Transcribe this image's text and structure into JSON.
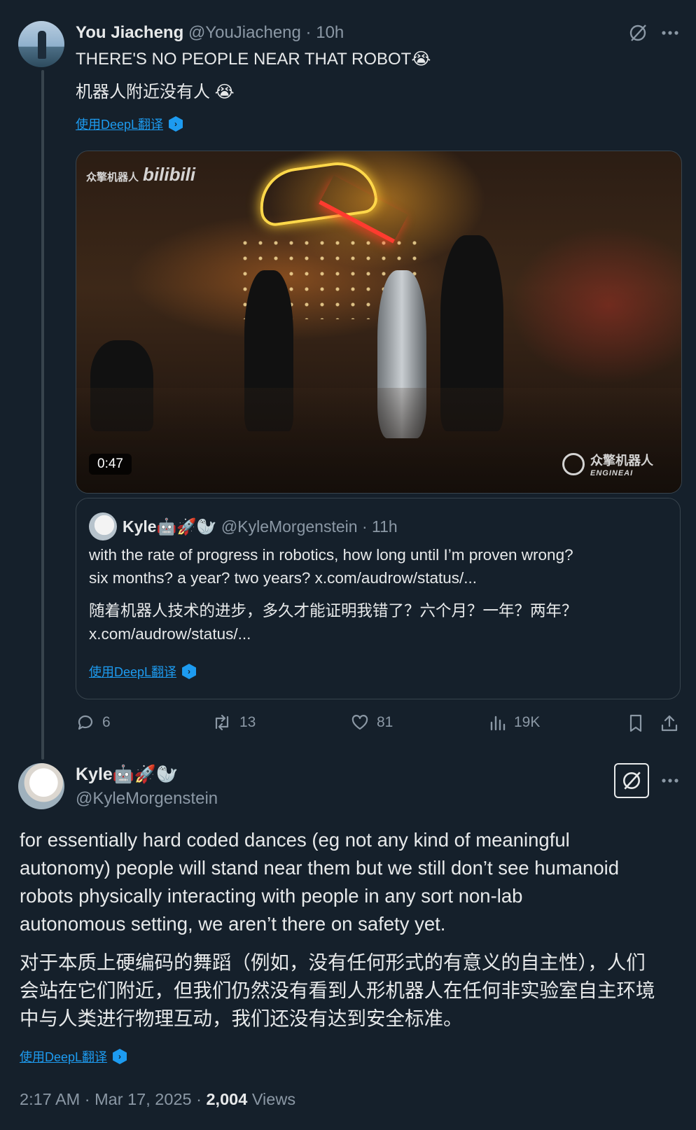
{
  "thread_tweet": {
    "author_name": "You Jiacheng",
    "handle": "@YouJiacheng",
    "separator": "·",
    "time": "10h",
    "text_en": "THERE'S NO PEOPLE NEAR THAT ROBOT😭",
    "text_zh": "机器人附近没有人 😭",
    "translate_label": "使用DeepL翻译",
    "video": {
      "duration": "0:47",
      "watermark_left": "众擎机器人",
      "watermark_bili": "bilibili",
      "watermark_right": "众擎机器人",
      "watermark_right_sub": "ENGINEAI"
    },
    "quoted": {
      "author_name": "Kyle🤖🚀🦭",
      "handle": "@KyleMorgenstein",
      "separator": "·",
      "time": "11h",
      "line1": "with the rate of progress in robotics, how long until I’m proven wrong?",
      "line2": "six months? a year? two years? x.com/audrow/status/...",
      "line3": "随着机器人技术的进步，多久才能证明我错了？六个月？一年？两年？",
      "line4": "x.com/audrow/status/...",
      "translate_label": "使用DeepL翻译"
    },
    "actions": {
      "replies": "6",
      "reposts": "13",
      "likes": "81",
      "views": "19K"
    }
  },
  "main_tweet": {
    "author_name": "Kyle🤖🚀🦭",
    "handle": "@KyleMorgenstein",
    "en_lines": [
      "for essentially hard coded dances (eg not any kind of meaningful",
      "autonomy) people will stand near them but we still don’t see humanoid",
      "robots physically interacting with people in any sort non-lab",
      "autonomous setting, we aren’t there on safety yet."
    ],
    "zh_lines": [
      "对于本质上硬编码的舞蹈（例如，没有任何形式的有意义的自主性），人们",
      "会站在它们附近，但我们仍然没有看到人形机器人在任何非实验室自主环境",
      "中与人类进行物理互动，我们还没有达到安全标准。"
    ],
    "translate_label": "使用DeepL翻译",
    "timestamp": "2:17 AM · Mar 17, 2025 ·",
    "views_count": "2,004",
    "views_label": "Views"
  },
  "icons": {
    "grok": "grok-slash-icon",
    "more": "more-dots-icon",
    "reply": "reply-bubble-icon",
    "repost": "repost-arrows-icon",
    "like": "heart-icon",
    "views": "bar-chart-icon",
    "bookmark": "bookmark-icon",
    "share": "share-upload-icon"
  },
  "colors": {
    "background": "#15202b",
    "text": "#e7e9ea",
    "muted": "#8b98a5",
    "link": "#1d9bf0",
    "border": "#38444d"
  }
}
